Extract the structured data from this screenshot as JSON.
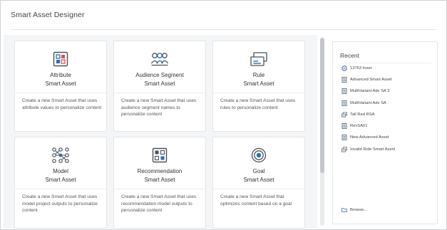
{
  "app": {
    "title": "Smart Asset Designer"
  },
  "cards": [
    {
      "icon": "attribute-icon",
      "title": "Attribute",
      "subtitle": "Smart Asset",
      "description": "Create a new Smart Asset that uses attribute values to personalize content"
    },
    {
      "icon": "audience-segment-icon",
      "title": "Audience Segment",
      "subtitle": "Smart Asset",
      "description": "Create a new Smart Asset that uses audience segment names to personalize content"
    },
    {
      "icon": "rule-icon",
      "title": "Rule",
      "subtitle": "Smart Asset",
      "description": "Create a new Smart Asset that uses rules to personalize content"
    },
    {
      "icon": "model-icon",
      "title": "Model",
      "subtitle": "Smart Asset",
      "description": "Create a new Smart Asset that uses model project outputs to personalize content"
    },
    {
      "icon": "recommendation-icon",
      "title": "Recommendation",
      "subtitle": "Smart Asset",
      "description": "Create a new Smart Asset that uses recommendation model outputs to personalize content"
    },
    {
      "icon": "goal-icon",
      "title": "Goal",
      "subtitle": "Smart Asset",
      "description": "Create a new Smart Asset that optimizes content based on a goal"
    }
  ],
  "recent": {
    "title": "Recent",
    "items": [
      {
        "icon": "link-icon",
        "label": "13763 Inser"
      },
      {
        "icon": "document-icon",
        "label": "Advanced Smart Asset"
      },
      {
        "icon": "document-icon",
        "label": "MultiVariant Adv SA 3"
      },
      {
        "icon": "document-icon",
        "label": "MultiVariant Adv SA"
      },
      {
        "icon": "rule-asset-icon",
        "label": "Tall Red RSA"
      },
      {
        "icon": "document-icon",
        "label": "RevSA01"
      },
      {
        "icon": "document-icon",
        "label": "New Advanced Asset"
      },
      {
        "icon": "rule-asset-icon",
        "label": "Invalid Rule Smart Asset"
      }
    ],
    "browse_label": "Browse..."
  },
  "colors": {
    "accent_blue": "#2f6ea8",
    "accent_red": "#d9534f",
    "icon_gray": "#4a5260",
    "border": "#e3e5e8",
    "panel_bg": "#f4f5f6"
  }
}
